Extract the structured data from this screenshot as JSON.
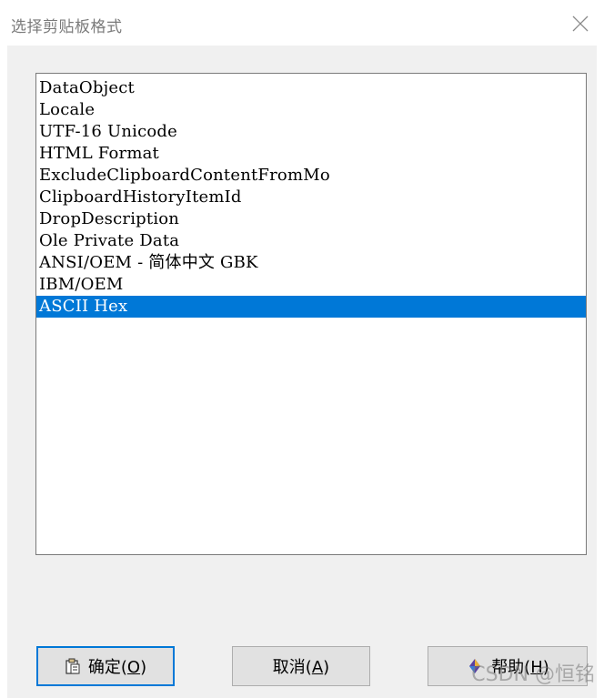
{
  "window": {
    "title": "选择剪贴板格式",
    "close_icon": "close-icon"
  },
  "formats": {
    "items": [
      "DataObject",
      "Locale",
      "UTF-16 Unicode",
      "HTML Format",
      "ExcludeClipboardContentFromMo",
      "ClipboardHistoryItemId",
      "DropDescription",
      "Ole Private Data",
      "ANSI/OEM - 简体中文 GBK",
      "IBM/OEM",
      "ASCII Hex"
    ],
    "selected": "ASCII Hex"
  },
  "buttons": {
    "ok_label": "确定(",
    "ok_mnemonic": "O",
    "ok_suffix": ")",
    "ok_icon": "clipboard-icon",
    "cancel_label": "取消(",
    "cancel_mnemonic": "A",
    "cancel_suffix": ")",
    "help_label": "帮助(",
    "help_mnemonic": "H",
    "help_suffix": ")",
    "help_icon": "help-icon"
  },
  "watermark": "CSDN @恒铭",
  "colors": {
    "selection": "#0078d7",
    "dialog_bg": "#f0f0f0"
  }
}
